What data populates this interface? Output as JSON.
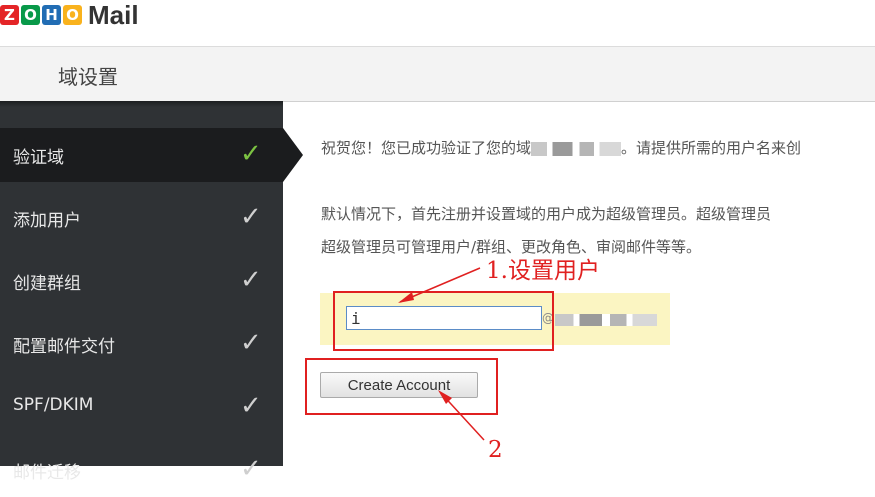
{
  "app": {
    "logo_letters": [
      "Z",
      "O",
      "H",
      "O"
    ],
    "logo_colors": [
      "#e42527",
      "#089949",
      "#226db4",
      "#f9b21d"
    ],
    "logo_word": "Mail"
  },
  "header": {
    "title": "域设置"
  },
  "sidebar": {
    "items": [
      {
        "label": "验证域",
        "active": true,
        "completed": true
      },
      {
        "label": "添加用户",
        "completed": true
      },
      {
        "label": "创建群组",
        "completed": true
      },
      {
        "label": "配置邮件交付",
        "completed": true
      },
      {
        "label": "SPF/DKIM",
        "completed": true
      },
      {
        "label": "邮件迁移",
        "completed": true
      }
    ],
    "check_glyph": "✓"
  },
  "main": {
    "congrats_before": "祝贺您！您已成功验证了您的域",
    "congrats_after": "。请提供所需的用户名来创",
    "info_line1": "默认情况下，首先注册并设置域的用户成为超级管理员。超级管理员",
    "info_line2": "超级管理员可管理用户/群组、更改角色、审阅邮件等等。",
    "username_value": "i",
    "at_sign": "@",
    "create_button": "Create Account"
  },
  "annotations": {
    "label1": "1.设置用户",
    "label2": "2",
    "color": "#e02020"
  }
}
